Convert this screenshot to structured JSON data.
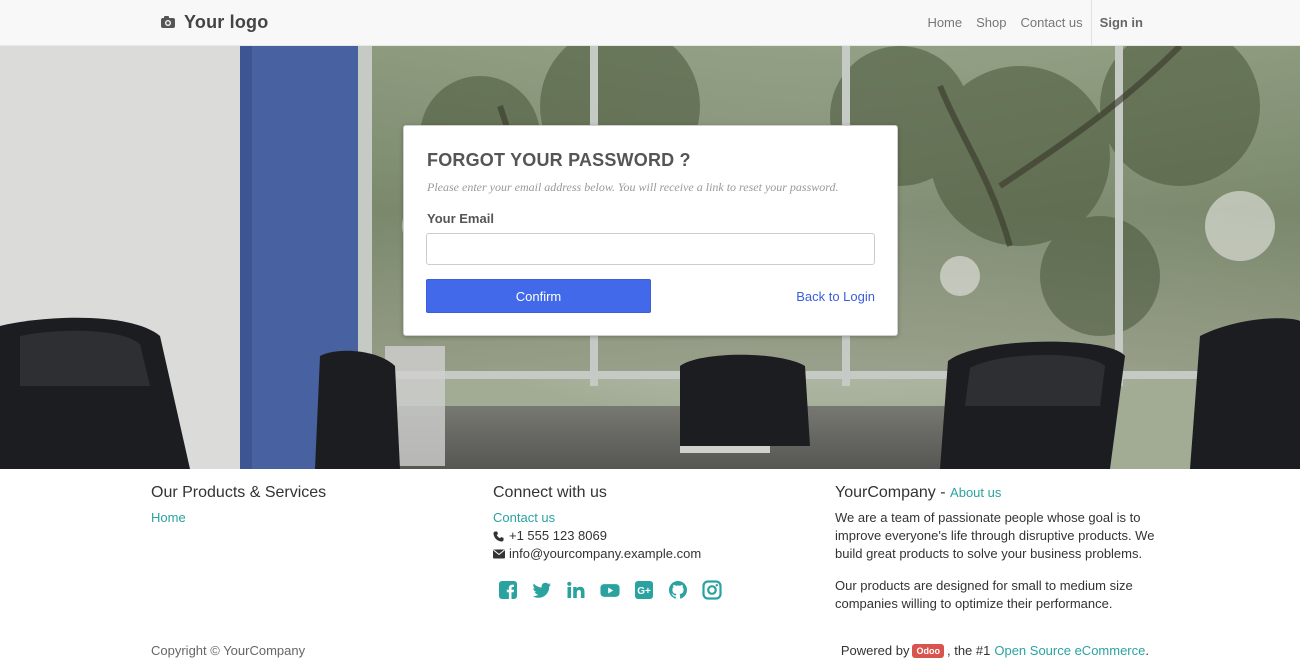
{
  "navbar": {
    "logo_text": "Your logo",
    "links": [
      "Home",
      "Shop",
      "Contact us"
    ],
    "signin": "Sign in"
  },
  "card": {
    "title": "FORGOT YOUR PASSWORD ?",
    "hint": "Please enter your email address below. You will receive a link to reset your password.",
    "email_label": "Your Email",
    "email_value": "",
    "email_placeholder": "",
    "confirm_label": "Confirm",
    "back_label": "Back to Login"
  },
  "footer": {
    "col1": {
      "title": "Our Products & Services",
      "link": "Home"
    },
    "col2": {
      "title": "Connect with us",
      "contact_link": "Contact us",
      "phone": "+1 555 123 8069",
      "email": "info@yourcompany.example.com",
      "socials": [
        "facebook-icon",
        "twitter-icon",
        "linkedin-icon",
        "youtube-icon",
        "google-plus-icon",
        "github-icon",
        "instagram-icon"
      ]
    },
    "col3": {
      "title": "YourCompany",
      "separator": "-",
      "about_link": "About us",
      "p1": "We are a team of passionate people whose goal is to improve everyone's life through disruptive products. We build great products to solve your business problems.",
      "p2": "Our products are designed for small to medium size companies willing to optimize their performance."
    },
    "copyright": "Copyright © YourCompany",
    "powered_prefix": "Powered by",
    "powered_badge": "Odoo",
    "powered_middle": ", the #1",
    "powered_link": "Open Source eCommerce",
    "powered_suffix": "."
  },
  "colors": {
    "accent_teal": "#2aa3a0",
    "button_blue": "#4169e9",
    "odoo_badge": "#d9534f"
  }
}
